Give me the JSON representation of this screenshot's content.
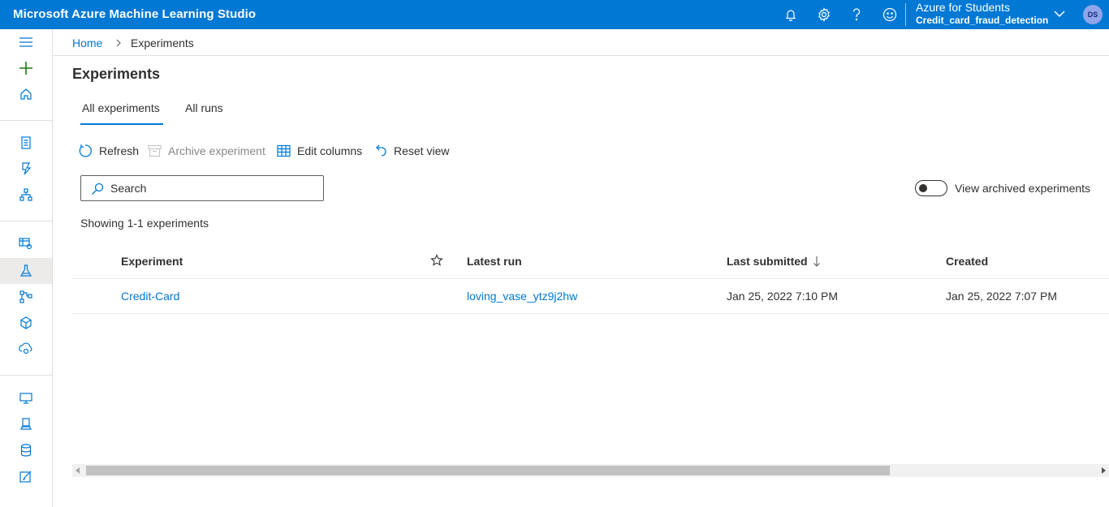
{
  "header": {
    "app_title": "Microsoft Azure Machine Learning Studio",
    "subscription": "Azure for Students",
    "workspace": "Credit_card_fraud_detection",
    "avatar_initials": "DS",
    "icons": [
      "bell-icon",
      "gear-icon",
      "help-icon",
      "smiley-icon",
      "chevron-down-icon"
    ]
  },
  "leftnav": {
    "icons": [
      "hamburger-icon",
      "plus-icon",
      "home-icon",
      "notebook-icon",
      "automl-icon",
      "designer-icon",
      "datasets-icon",
      "experiments-icon",
      "pipelines-icon",
      "models-icon",
      "endpoints-icon",
      "compute-icon",
      "environments-icon",
      "datastores-icon",
      "labeling-icon"
    ],
    "active": "experiments-icon"
  },
  "breadcrumb": {
    "home": "Home",
    "current": "Experiments"
  },
  "page": {
    "title": "Experiments"
  },
  "tabs": [
    {
      "label": "All experiments",
      "active": true
    },
    {
      "label": "All runs",
      "active": false
    }
  ],
  "toolbar": {
    "refresh": "Refresh",
    "archive": "Archive experiment",
    "edit_columns": "Edit columns",
    "reset_view": "Reset view"
  },
  "search": {
    "placeholder": "Search",
    "value": ""
  },
  "archived_toggle": {
    "label": "View archived experiments",
    "on": false
  },
  "showing": "Showing 1-1 experiments",
  "table": {
    "columns": [
      "Experiment",
      "Latest run",
      "Last submitted",
      "Created"
    ],
    "rows": [
      {
        "experiment": "Credit-Card",
        "latest_run": "loving_vase_ytz9j2hw",
        "last_submitted": "Jan 25, 2022 7:10 PM",
        "created": "Jan 25, 2022 7:07 PM"
      }
    ]
  },
  "colors": {
    "brand": "#0078d4",
    "accent_green": "#107c10",
    "text": "#323130"
  }
}
